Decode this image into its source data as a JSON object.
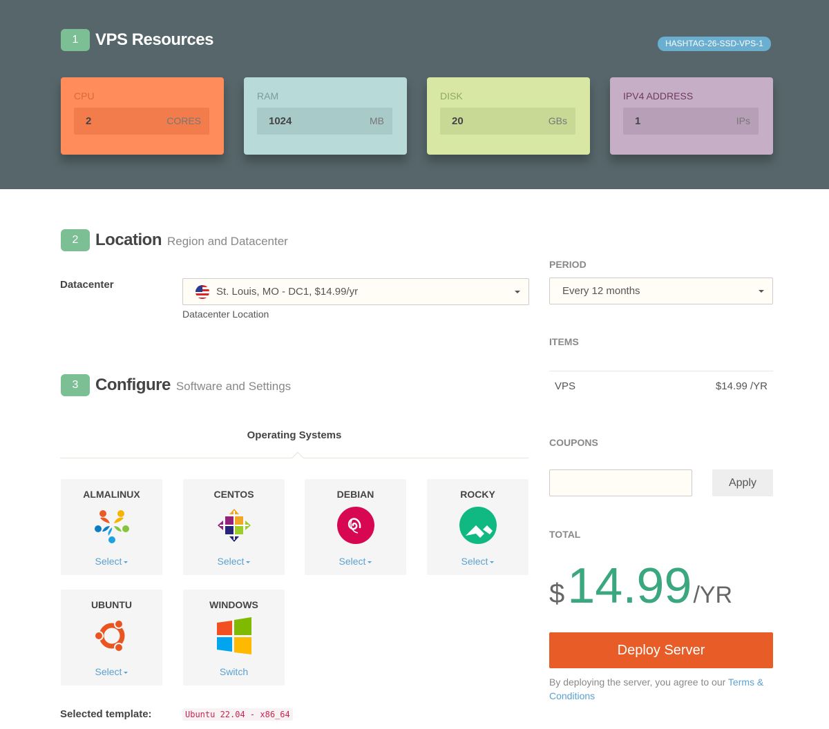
{
  "resources": {
    "step": "1",
    "title": "VPS Resources",
    "product_badge": "HASHTAG-26-SSD-VPS-1",
    "cards": [
      {
        "label": "CPU",
        "value": "2",
        "unit": "CORES",
        "bg": "#ff8c5a",
        "box": "#f27c4c",
        "label_color": "#d7693f"
      },
      {
        "label": "RAM",
        "value": "1024",
        "unit": "MB",
        "bg": "#b8dad8",
        "box": "#a8cbc9",
        "label_color": "#7a9c9a"
      },
      {
        "label": "DISK",
        "value": "20",
        "unit": "GBs",
        "bg": "#d8e8a4",
        "box": "#c8d996",
        "label_color": "#8fa85e"
      },
      {
        "label": "IPV4 ADDRESS",
        "value": "1",
        "unit": "IPs",
        "bg": "#c6aec6",
        "box": "#b79fb7",
        "label_color": "#6d3a5e"
      }
    ]
  },
  "location": {
    "step": "2",
    "title": "Location",
    "subtitle": "Region and Datacenter",
    "datacenter_label": "Datacenter",
    "datacenter_value": "St. Louis, MO - DC1, $14.99/yr",
    "datacenter_help": "Datacenter Location"
  },
  "configure": {
    "step": "3",
    "title": "Configure",
    "subtitle": "Software and Settings",
    "tab_label": "Operating Systems",
    "os": [
      {
        "name": "ALMALINUX",
        "action": "Select",
        "icon": "almalinux-icon"
      },
      {
        "name": "CENTOS",
        "action": "Select",
        "icon": "centos-icon"
      },
      {
        "name": "DEBIAN",
        "action": "Select",
        "icon": "debian-icon"
      },
      {
        "name": "ROCKY",
        "action": "Select",
        "icon": "rocky-icon"
      },
      {
        "name": "UBUNTU",
        "action": "Select",
        "icon": "ubuntu-icon"
      },
      {
        "name": "WINDOWS",
        "action": "Switch",
        "icon": "windows-icon"
      }
    ],
    "selected_template_label": "Selected template:",
    "selected_template_value": "Ubuntu 22.04 - x86_64"
  },
  "sidebar": {
    "period_label": "PERIOD",
    "period_value": "Every 12 months",
    "items_label": "ITEMS",
    "items": [
      {
        "name": "VPS",
        "price": "$14.99 /YR"
      }
    ],
    "coupons_label": "COUPONS",
    "apply_label": "Apply",
    "total_label": "TOTAL",
    "total_currency": "$",
    "total_amount": "14.99",
    "total_period": "/YR",
    "deploy_label": "Deploy Server",
    "legal_text": "By deploying the server, you agree to our ",
    "legal_link": "Terms & Conditions"
  },
  "colors": {
    "accent_green": "#7dbf95",
    "total_green": "#3aa77f",
    "deploy_orange": "#e85d27",
    "link_blue": "#5aa1d0"
  }
}
